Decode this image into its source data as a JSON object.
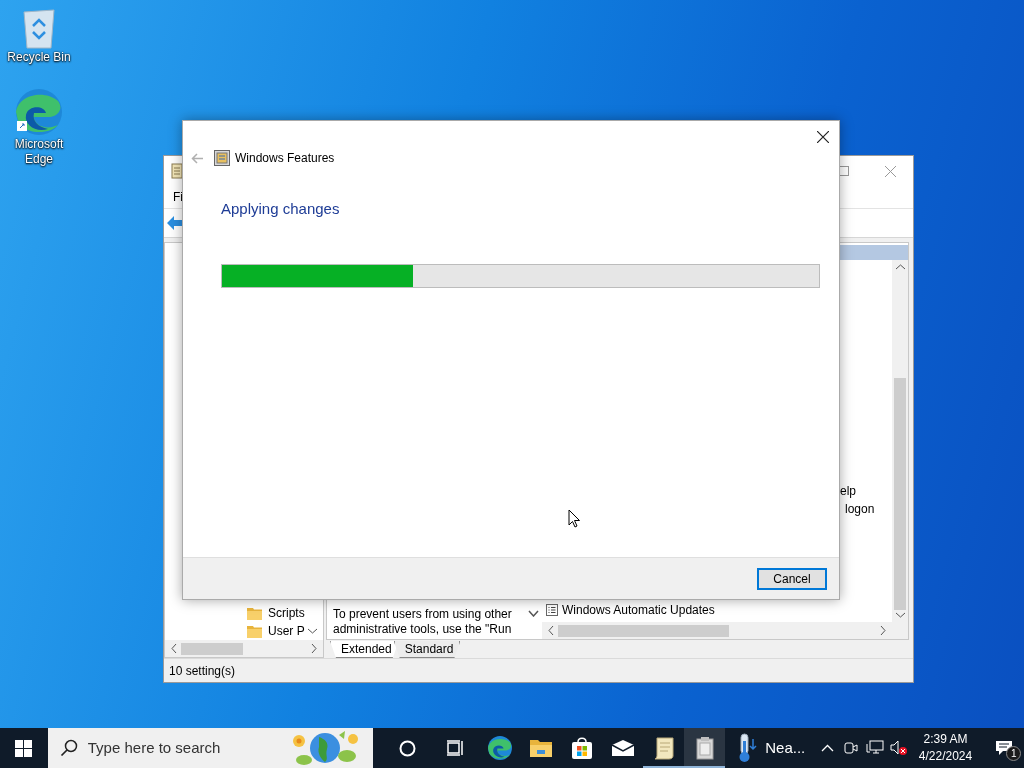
{
  "desktop_icons": [
    {
      "kind": "recycle",
      "label": "Recycle Bin"
    },
    {
      "kind": "edge",
      "label": "Microsoft Edge"
    }
  ],
  "back_window": {
    "menu": [
      "Fi"
    ],
    "tree_items": [
      "Scripts",
      "User P"
    ],
    "description": "To prevent users from using other administrative tools, use the \"Run",
    "list_fragments": [
      "elp",
      "logon"
    ],
    "list_item": "Windows Automatic Updates",
    "tabs": [
      {
        "label": "Extended",
        "selected": true
      },
      {
        "label": "Standard",
        "selected": false
      }
    ],
    "status": "10 setting(s)"
  },
  "dialog": {
    "title": "Windows Features",
    "heading": "Applying changes",
    "progress": {
      "level": 0.32
    },
    "buttons": [
      "Cancel"
    ]
  },
  "taskbar": {
    "search": {
      "placeholder": "Type here to search"
    },
    "apps": [
      {
        "kind": "cortana",
        "running": false,
        "active": false
      },
      {
        "kind": "taskview",
        "running": false,
        "active": false
      },
      {
        "kind": "edge",
        "running": false,
        "active": false
      },
      {
        "kind": "folder",
        "running": false,
        "active": false
      },
      {
        "kind": "store",
        "running": false,
        "active": false
      },
      {
        "kind": "mail",
        "running": false,
        "active": false
      },
      {
        "kind": "scroll",
        "running": true,
        "active": false
      },
      {
        "kind": "features",
        "running": true,
        "active": true
      }
    ],
    "weather": "Nea...",
    "clock": {
      "time": "2:39 AM",
      "date": "4/22/2024"
    },
    "notifications": "1"
  }
}
